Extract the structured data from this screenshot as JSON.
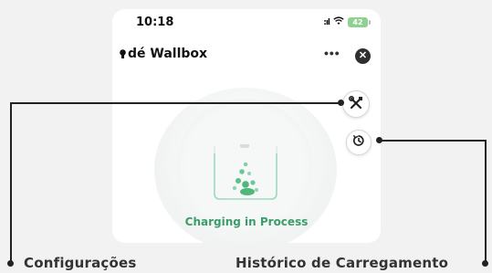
{
  "status_bar": {
    "time": "10:18",
    "signal": ":ıl",
    "wifi": "wifi",
    "battery": "42"
  },
  "app": {
    "title": "dé Wallbox",
    "more_label": "•••",
    "close_label": "✕"
  },
  "charging": {
    "status": "Charging in Process"
  },
  "annotations": {
    "settings_label": "Configurações",
    "history_label": "Histórico de Carregamento"
  },
  "colors": {
    "accent": "#3a9d6a",
    "background": "#f2f2f2",
    "callout": "#222222"
  },
  "icons": {
    "title": "bulb-icon",
    "tools": "wrench-screwdriver-icon",
    "history": "history-clock-icon",
    "close": "close-icon",
    "charger": "charger-icon"
  }
}
